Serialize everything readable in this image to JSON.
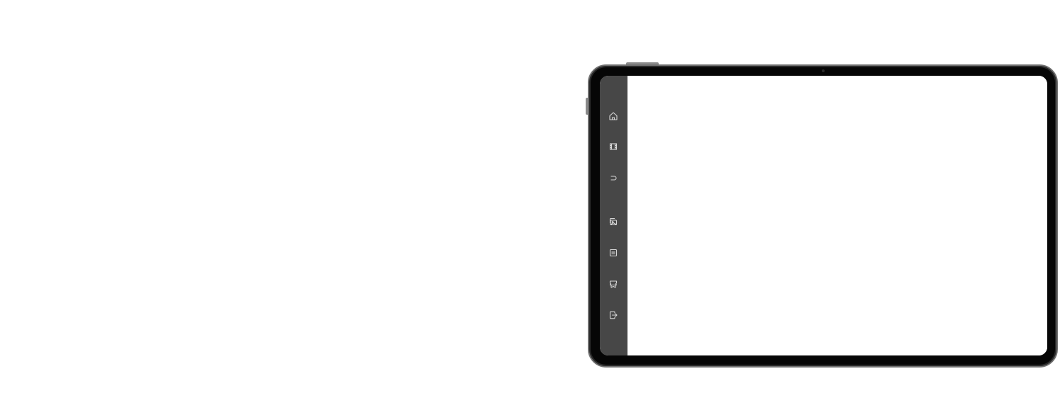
{
  "device": {
    "frame_color": "#060606",
    "bezel_highlight": "#6f6f6f"
  },
  "sidebar": {
    "background": "#474747",
    "icon_color": "#d6d6d6",
    "items": [
      {
        "icon": "home-icon"
      },
      {
        "icon": "film-icon"
      },
      {
        "icon": "undo-icon"
      },
      {
        "icon": "gallery-icon"
      },
      {
        "icon": "save-icon"
      },
      {
        "icon": "ticket-icon"
      },
      {
        "icon": "exit-icon"
      }
    ]
  },
  "content": {
    "background": "#ffffff"
  }
}
